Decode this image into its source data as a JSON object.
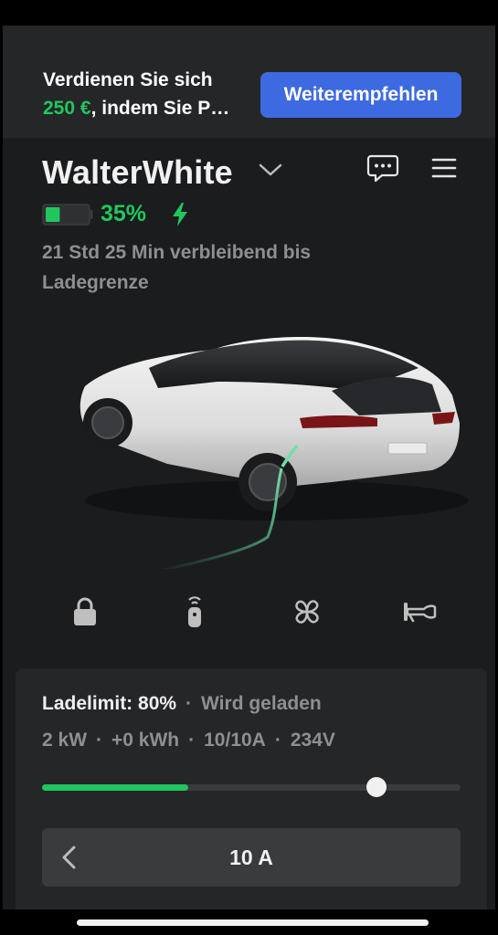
{
  "promo": {
    "line1": "Verdienen Sie sich",
    "amount": "250 €",
    "line2_rest": ", indem Sie P…",
    "button_label": "Weiterempfehlen"
  },
  "vehicle": {
    "name": "WalterWhite",
    "battery_percent_text": "35%",
    "battery_level": 0.35,
    "remaining_text": "21 Std 25 Min verbleibend bis Ladegrenze"
  },
  "controls": {
    "icons": [
      "lock-icon",
      "remote-icon",
      "fan-icon",
      "horn-icon"
    ]
  },
  "charging": {
    "limit_label": "Ladelimit: 80%",
    "status": "Wird geladen",
    "stats": [
      "2 kW",
      "+0 kWh",
      "10/10A",
      "234V"
    ],
    "limit_fraction": 0.8,
    "charge_fraction": 0.35,
    "current_label": "10 A"
  },
  "colors": {
    "accent_green": "#20c75e",
    "button_blue": "#3e6ae1",
    "background": "#1b1c1e",
    "panel": "#252628"
  }
}
